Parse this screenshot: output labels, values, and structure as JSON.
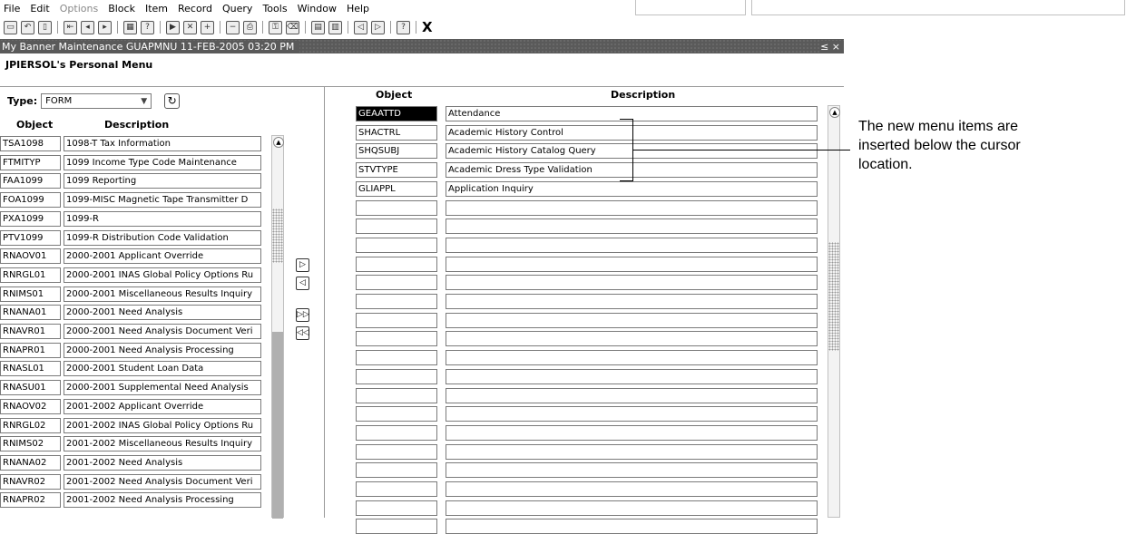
{
  "menu": {
    "items": [
      {
        "label": "File",
        "enabled": true
      },
      {
        "label": "Edit",
        "enabled": true
      },
      {
        "label": "Options",
        "enabled": false
      },
      {
        "label": "Block",
        "enabled": true
      },
      {
        "label": "Item",
        "enabled": true
      },
      {
        "label": "Record",
        "enabled": true
      },
      {
        "label": "Query",
        "enabled": true
      },
      {
        "label": "Tools",
        "enabled": true
      },
      {
        "label": "Window",
        "enabled": true
      },
      {
        "label": "Help",
        "enabled": true
      }
    ]
  },
  "toolbar": {
    "exit_label": "X",
    "icons": [
      "save-icon",
      "rollback-icon",
      "new-doc-icon",
      "first-record-icon",
      "previous-block-icon",
      "next-block-icon",
      "print-preview-icon",
      "enter-query-icon",
      "execute-query-icon",
      "cancel-query-icon",
      "insert-record-icon",
      "remove-record-icon",
      "print-icon",
      "lock-record-icon",
      "clear-record-icon",
      "clear-block-icon",
      "clear-form-icon",
      "previous-item-icon",
      "next-item-icon",
      "help-icon"
    ]
  },
  "window": {
    "title": "My Banner Maintenance  GUAPMNU   11-FEB-2005 03:20 PM",
    "controls": "≤ ×"
  },
  "personal_menu": {
    "heading": "JPIERSOL's Personal Menu"
  },
  "left": {
    "type_label": "Type:",
    "type_value": "FORM",
    "col_object": "Object",
    "col_description": "Description",
    "rows": [
      {
        "object": "TSA1098",
        "description": "1098-T Tax Information"
      },
      {
        "object": "FTMITYP",
        "description": "1099 Income Type Code Maintenance"
      },
      {
        "object": "FAA1099",
        "description": "1099 Reporting"
      },
      {
        "object": "FOA1099",
        "description": "1099-MISC Magnetic Tape Transmitter D"
      },
      {
        "object": "PXA1099",
        "description": "1099-R"
      },
      {
        "object": "PTV1099",
        "description": "1099-R Distribution Code Validation"
      },
      {
        "object": "RNAOV01",
        "description": "2000-2001 Applicant Override"
      },
      {
        "object": "RNRGL01",
        "description": "2000-2001 INAS Global Policy Options Ru"
      },
      {
        "object": "RNIMS01",
        "description": "2000-2001 Miscellaneous Results Inquiry"
      },
      {
        "object": "RNANA01",
        "description": "2000-2001 Need Analysis"
      },
      {
        "object": "RNAVR01",
        "description": "2000-2001 Need Analysis Document Veri"
      },
      {
        "object": "RNAPR01",
        "description": "2000-2001 Need Analysis Processing"
      },
      {
        "object": "RNASL01",
        "description": "2000-2001 Student Loan Data"
      },
      {
        "object": "RNASU01",
        "description": "2000-2001 Supplemental Need Analysis"
      },
      {
        "object": "RNAOV02",
        "description": "2001-2002 Applicant Override"
      },
      {
        "object": "RNRGL02",
        "description": "2001-2002 INAS Global Policy Options Ru"
      },
      {
        "object": "RNIMS02",
        "description": "2001-2002 Miscellaneous Results Inquiry"
      },
      {
        "object": "RNANA02",
        "description": "2001-2002 Need Analysis"
      },
      {
        "object": "RNAVR02",
        "description": "2001-2002 Need Analysis Document Veri"
      },
      {
        "object": "RNAPR02",
        "description": "2001-2002 Need Analysis Processing"
      }
    ]
  },
  "right": {
    "col_object": "Object",
    "col_description": "Description",
    "rows": [
      {
        "object": "GEAATTD",
        "description": "Attendance"
      },
      {
        "object": "SHACTRL",
        "description": "Academic History Control"
      },
      {
        "object": "SHQSUBJ",
        "description": "Academic History Catalog Query"
      },
      {
        "object": "STVTYPE",
        "description": "Academic Dress Type Validation"
      },
      {
        "object": "GLIAPPL",
        "description": "Application Inquiry"
      },
      {
        "object": "",
        "description": ""
      },
      {
        "object": "",
        "description": ""
      },
      {
        "object": "",
        "description": ""
      },
      {
        "object": "",
        "description": ""
      },
      {
        "object": "",
        "description": ""
      },
      {
        "object": "",
        "description": ""
      },
      {
        "object": "",
        "description": ""
      },
      {
        "object": "",
        "description": ""
      },
      {
        "object": "",
        "description": ""
      },
      {
        "object": "",
        "description": ""
      },
      {
        "object": "",
        "description": ""
      },
      {
        "object": "",
        "description": ""
      },
      {
        "object": "",
        "description": ""
      },
      {
        "object": "",
        "description": ""
      },
      {
        "object": "",
        "description": ""
      },
      {
        "object": "",
        "description": ""
      },
      {
        "object": "",
        "description": ""
      },
      {
        "object": "",
        "description": ""
      }
    ]
  },
  "callout": {
    "text": "The new menu items are inserted below the cursor location."
  }
}
